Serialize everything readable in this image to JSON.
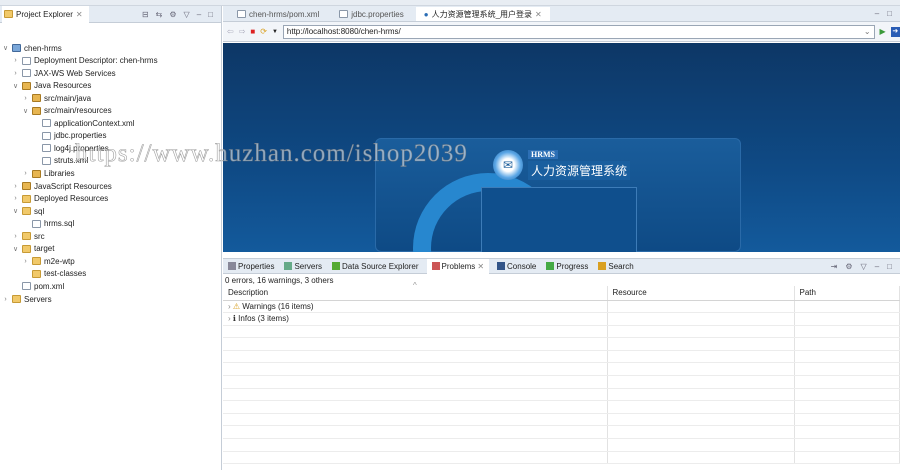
{
  "explorer": {
    "title": "Project Explorer",
    "tree": [
      {
        "label": "chen-hrms",
        "depth": 0,
        "chev": "v",
        "icon": "proj"
      },
      {
        "label": "Deployment Descriptor: chen-hrms",
        "depth": 1,
        "chev": ">",
        "icon": "file"
      },
      {
        "label": "JAX-WS Web Services",
        "depth": 1,
        "chev": ">",
        "icon": "file"
      },
      {
        "label": "Java Resources",
        "depth": 1,
        "chev": "v",
        "icon": "pkg"
      },
      {
        "label": "src/main/java",
        "depth": 2,
        "chev": ">",
        "icon": "pkg"
      },
      {
        "label": "src/main/resources",
        "depth": 2,
        "chev": "v",
        "icon": "pkg"
      },
      {
        "label": "applicationContext.xml",
        "depth": 3,
        "chev": "",
        "icon": "file"
      },
      {
        "label": "jdbc.properties",
        "depth": 3,
        "chev": "",
        "icon": "file"
      },
      {
        "label": "log4j.properties",
        "depth": 3,
        "chev": "",
        "icon": "file"
      },
      {
        "label": "struts.xml",
        "depth": 3,
        "chev": "",
        "icon": "file"
      },
      {
        "label": "Libraries",
        "depth": 2,
        "chev": ">",
        "icon": "pkg"
      },
      {
        "label": "JavaScript Resources",
        "depth": 1,
        "chev": ">",
        "icon": "pkg"
      },
      {
        "label": "Deployed Resources",
        "depth": 1,
        "chev": ">",
        "icon": "fold"
      },
      {
        "label": "sql",
        "depth": 1,
        "chev": "v",
        "icon": "fold"
      },
      {
        "label": "hrms.sql",
        "depth": 2,
        "chev": "",
        "icon": "file"
      },
      {
        "label": "src",
        "depth": 1,
        "chev": ">",
        "icon": "fold"
      },
      {
        "label": "target",
        "depth": 1,
        "chev": "v",
        "icon": "fold"
      },
      {
        "label": "m2e-wtp",
        "depth": 2,
        "chev": ">",
        "icon": "fold"
      },
      {
        "label": "test-classes",
        "depth": 2,
        "chev": "",
        "icon": "fold"
      },
      {
        "label": "pom.xml",
        "depth": 1,
        "chev": "",
        "icon": "file"
      },
      {
        "label": "Servers",
        "depth": 0,
        "chev": ">",
        "icon": "fold"
      }
    ]
  },
  "editor": {
    "tabs": [
      {
        "label": "chen-hrms/pom.xml"
      },
      {
        "label": "jdbc.properties"
      },
      {
        "label": "人力资源管理系统_用户登录",
        "active": true
      }
    ],
    "url": "http://localhost:8080/chen-hrms/"
  },
  "page": {
    "badge": "HRMS",
    "system_name": "人力资源管理系统"
  },
  "panel": {
    "tabs": [
      "Properties",
      "Servers",
      "Data Source Explorer",
      "Problems",
      "Console",
      "Progress",
      "Search"
    ],
    "active": "Problems",
    "status": "0 errors, 16 warnings, 3 others",
    "columns": [
      "Description",
      "Resource",
      "Path"
    ],
    "rows": [
      {
        "label": "Warnings (16 items)",
        "icon": "warning-icon"
      },
      {
        "label": "Infos (3 items)",
        "icon": "info-icon"
      }
    ]
  },
  "watermark": "https://www.huzhan.com/ishop2039"
}
